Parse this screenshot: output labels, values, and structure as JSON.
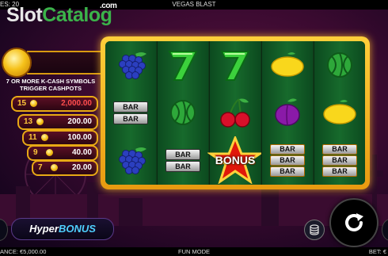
{
  "top_bar": {
    "lines_text": "ES: 20",
    "title": "VEGAS BLAST"
  },
  "watermark": {
    "part1": "Slot",
    "part2": "Catalog",
    "suffix": ".com"
  },
  "cashpots": {
    "trigger_text_line1": "7 OR MORE K-CASH SYMBOLS",
    "trigger_text_line2": "TRIGGER CASHPOTS",
    "rows": [
      {
        "count": "15",
        "value": "2,000.00",
        "color": "#ff4d4d"
      },
      {
        "count": "13",
        "value": "200.00",
        "color": "#ffffff"
      },
      {
        "count": "11",
        "value": "100.00",
        "color": "#ffffff"
      },
      {
        "count": "9",
        "value": "40.00",
        "color": "#ffffff"
      },
      {
        "count": "7",
        "value": "20.00",
        "color": "#ffffff"
      }
    ]
  },
  "reels": [
    [
      "grapes",
      "bar-double",
      "grapes"
    ],
    [
      "seven",
      "watermelon",
      "bar-double"
    ],
    [
      "seven",
      "cherries",
      "bonus-star"
    ],
    [
      "lemon",
      "plum",
      "bar-triple"
    ],
    [
      "watermelon",
      "lemon",
      "bar-triple"
    ]
  ],
  "bonus_label": "BONUS",
  "bar_label": "BAR",
  "feature_button": {
    "part1": "Hyper",
    "part2": "BONUS"
  },
  "footer": {
    "balance": "ANCE: €5,000.00",
    "mode": "FUN MODE",
    "bet": "BET: €"
  },
  "colors": {
    "frame_gold": "#f2b51f",
    "reel_green": "#176a2c",
    "accent_blue": "#4fd0ff"
  }
}
